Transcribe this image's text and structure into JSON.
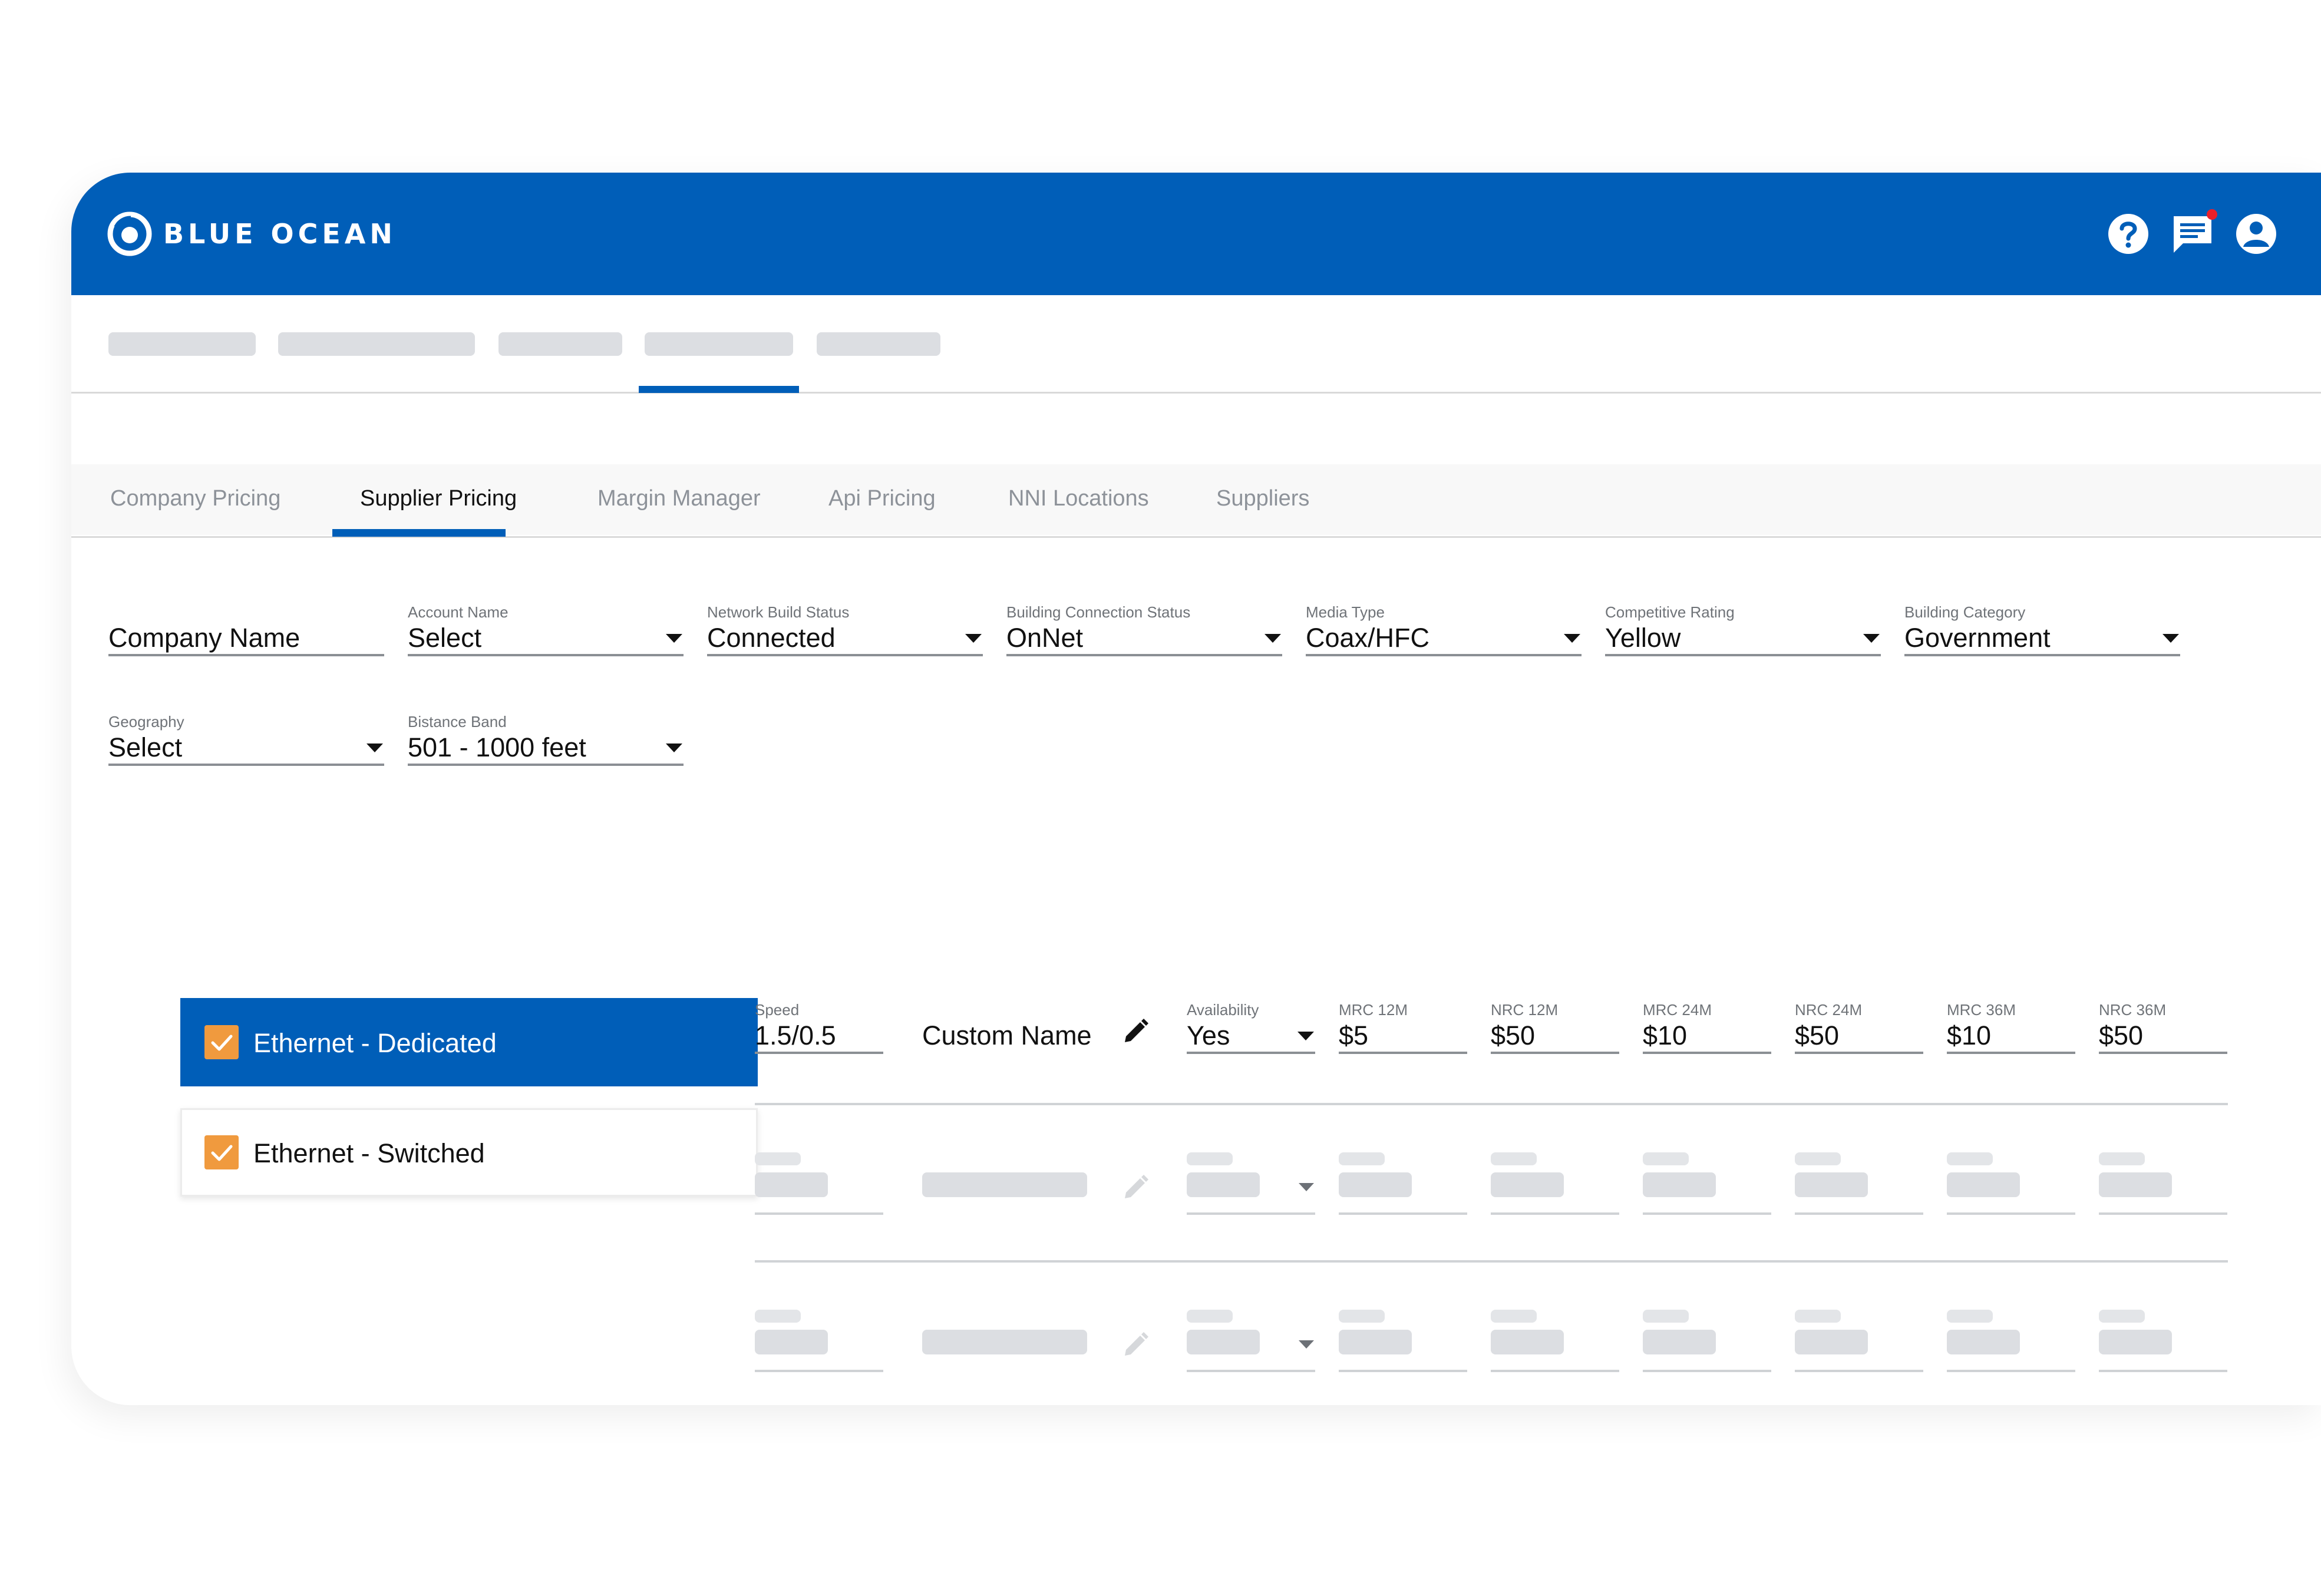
{
  "app": {
    "brand": "BLUE OCEAN"
  },
  "header_icons": [
    "help-icon",
    "chat-icon",
    "account-icon"
  ],
  "colors": {
    "primary": "#005eb8",
    "checkbox": "#f09a3e",
    "notification": "#ea1f2a"
  },
  "tabs": [
    {
      "label": "Company Pricing",
      "active": false
    },
    {
      "label": "Supplier Pricing",
      "active": true
    },
    {
      "label": "Margin Manager",
      "active": false
    },
    {
      "label": "Api Pricing",
      "active": false
    },
    {
      "label": "NNI Locations",
      "active": false
    },
    {
      "label": "Suppliers",
      "active": false
    }
  ],
  "filters": {
    "company_name": {
      "label": "",
      "value": "Company Name"
    },
    "account_name": {
      "label": "Account Name",
      "value": "Select"
    },
    "network_build_status": {
      "label": "Network Build Status",
      "value": "Connected"
    },
    "building_connection_status": {
      "label": "Building Connection Status",
      "value": "OnNet"
    },
    "media_type": {
      "label": "Media Type",
      "value": "Coax/HFC"
    },
    "competitive_rating": {
      "label": "Competitive Rating",
      "value": "Yellow"
    },
    "building_category": {
      "label": "Building Category",
      "value": "Government"
    },
    "geography": {
      "label": "Geography",
      "value": "Select"
    },
    "distance_band": {
      "label": "Bistance Band",
      "value": "501 - 1000 feet"
    }
  },
  "products": [
    {
      "label": "Ethernet - Dedicated",
      "checked": true,
      "selected": true
    },
    {
      "label": "Ethernet - Switched",
      "checked": true,
      "selected": false
    }
  ],
  "pricing_row": {
    "speed": {
      "label": "Speed",
      "value": "1.5/0.5"
    },
    "custom_name": "Custom Name",
    "availability": {
      "label": "Availability",
      "value": "Yes"
    },
    "mrc_12m": {
      "label": "MRC 12M",
      "value": "$5"
    },
    "nrc_12m": {
      "label": "NRC 12M",
      "value": "$50"
    },
    "mrc_24m": {
      "label": "MRC 24M",
      "value": "$10"
    },
    "nrc_24m": {
      "label": "NRC 24M",
      "value": "$50"
    },
    "mrc_36m": {
      "label": "MRC 36M",
      "value": "$10"
    },
    "nrc_36m": {
      "label": "NRC 36M",
      "value": "$50"
    }
  }
}
